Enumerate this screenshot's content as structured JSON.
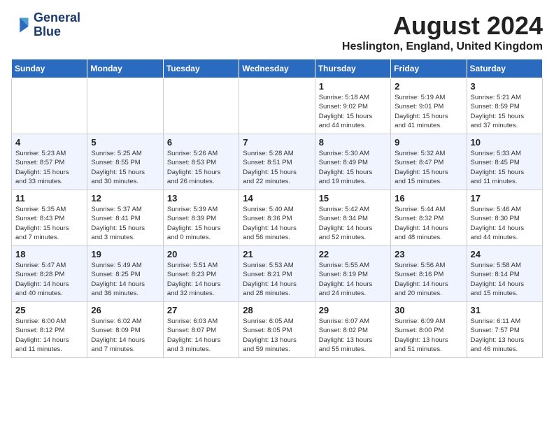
{
  "logo": {
    "line1": "General",
    "line2": "Blue"
  },
  "title": "August 2024",
  "location": "Heslington, England, United Kingdom",
  "days_of_week": [
    "Sunday",
    "Monday",
    "Tuesday",
    "Wednesday",
    "Thursday",
    "Friday",
    "Saturday"
  ],
  "weeks": [
    [
      {
        "day": "",
        "info": ""
      },
      {
        "day": "",
        "info": ""
      },
      {
        "day": "",
        "info": ""
      },
      {
        "day": "",
        "info": ""
      },
      {
        "day": "1",
        "info": "Sunrise: 5:18 AM\nSunset: 9:02 PM\nDaylight: 15 hours\nand 44 minutes."
      },
      {
        "day": "2",
        "info": "Sunrise: 5:19 AM\nSunset: 9:01 PM\nDaylight: 15 hours\nand 41 minutes."
      },
      {
        "day": "3",
        "info": "Sunrise: 5:21 AM\nSunset: 8:59 PM\nDaylight: 15 hours\nand 37 minutes."
      }
    ],
    [
      {
        "day": "4",
        "info": "Sunrise: 5:23 AM\nSunset: 8:57 PM\nDaylight: 15 hours\nand 33 minutes."
      },
      {
        "day": "5",
        "info": "Sunrise: 5:25 AM\nSunset: 8:55 PM\nDaylight: 15 hours\nand 30 minutes."
      },
      {
        "day": "6",
        "info": "Sunrise: 5:26 AM\nSunset: 8:53 PM\nDaylight: 15 hours\nand 26 minutes."
      },
      {
        "day": "7",
        "info": "Sunrise: 5:28 AM\nSunset: 8:51 PM\nDaylight: 15 hours\nand 22 minutes."
      },
      {
        "day": "8",
        "info": "Sunrise: 5:30 AM\nSunset: 8:49 PM\nDaylight: 15 hours\nand 19 minutes."
      },
      {
        "day": "9",
        "info": "Sunrise: 5:32 AM\nSunset: 8:47 PM\nDaylight: 15 hours\nand 15 minutes."
      },
      {
        "day": "10",
        "info": "Sunrise: 5:33 AM\nSunset: 8:45 PM\nDaylight: 15 hours\nand 11 minutes."
      }
    ],
    [
      {
        "day": "11",
        "info": "Sunrise: 5:35 AM\nSunset: 8:43 PM\nDaylight: 15 hours\nand 7 minutes."
      },
      {
        "day": "12",
        "info": "Sunrise: 5:37 AM\nSunset: 8:41 PM\nDaylight: 15 hours\nand 3 minutes."
      },
      {
        "day": "13",
        "info": "Sunrise: 5:39 AM\nSunset: 8:39 PM\nDaylight: 15 hours\nand 0 minutes."
      },
      {
        "day": "14",
        "info": "Sunrise: 5:40 AM\nSunset: 8:36 PM\nDaylight: 14 hours\nand 56 minutes."
      },
      {
        "day": "15",
        "info": "Sunrise: 5:42 AM\nSunset: 8:34 PM\nDaylight: 14 hours\nand 52 minutes."
      },
      {
        "day": "16",
        "info": "Sunrise: 5:44 AM\nSunset: 8:32 PM\nDaylight: 14 hours\nand 48 minutes."
      },
      {
        "day": "17",
        "info": "Sunrise: 5:46 AM\nSunset: 8:30 PM\nDaylight: 14 hours\nand 44 minutes."
      }
    ],
    [
      {
        "day": "18",
        "info": "Sunrise: 5:47 AM\nSunset: 8:28 PM\nDaylight: 14 hours\nand 40 minutes."
      },
      {
        "day": "19",
        "info": "Sunrise: 5:49 AM\nSunset: 8:25 PM\nDaylight: 14 hours\nand 36 minutes."
      },
      {
        "day": "20",
        "info": "Sunrise: 5:51 AM\nSunset: 8:23 PM\nDaylight: 14 hours\nand 32 minutes."
      },
      {
        "day": "21",
        "info": "Sunrise: 5:53 AM\nSunset: 8:21 PM\nDaylight: 14 hours\nand 28 minutes."
      },
      {
        "day": "22",
        "info": "Sunrise: 5:55 AM\nSunset: 8:19 PM\nDaylight: 14 hours\nand 24 minutes."
      },
      {
        "day": "23",
        "info": "Sunrise: 5:56 AM\nSunset: 8:16 PM\nDaylight: 14 hours\nand 20 minutes."
      },
      {
        "day": "24",
        "info": "Sunrise: 5:58 AM\nSunset: 8:14 PM\nDaylight: 14 hours\nand 15 minutes."
      }
    ],
    [
      {
        "day": "25",
        "info": "Sunrise: 6:00 AM\nSunset: 8:12 PM\nDaylight: 14 hours\nand 11 minutes."
      },
      {
        "day": "26",
        "info": "Sunrise: 6:02 AM\nSunset: 8:09 PM\nDaylight: 14 hours\nand 7 minutes."
      },
      {
        "day": "27",
        "info": "Sunrise: 6:03 AM\nSunset: 8:07 PM\nDaylight: 14 hours\nand 3 minutes."
      },
      {
        "day": "28",
        "info": "Sunrise: 6:05 AM\nSunset: 8:05 PM\nDaylight: 13 hours\nand 59 minutes."
      },
      {
        "day": "29",
        "info": "Sunrise: 6:07 AM\nSunset: 8:02 PM\nDaylight: 13 hours\nand 55 minutes."
      },
      {
        "day": "30",
        "info": "Sunrise: 6:09 AM\nSunset: 8:00 PM\nDaylight: 13 hours\nand 51 minutes."
      },
      {
        "day": "31",
        "info": "Sunrise: 6:11 AM\nSunset: 7:57 PM\nDaylight: 13 hours\nand 46 minutes."
      }
    ]
  ]
}
